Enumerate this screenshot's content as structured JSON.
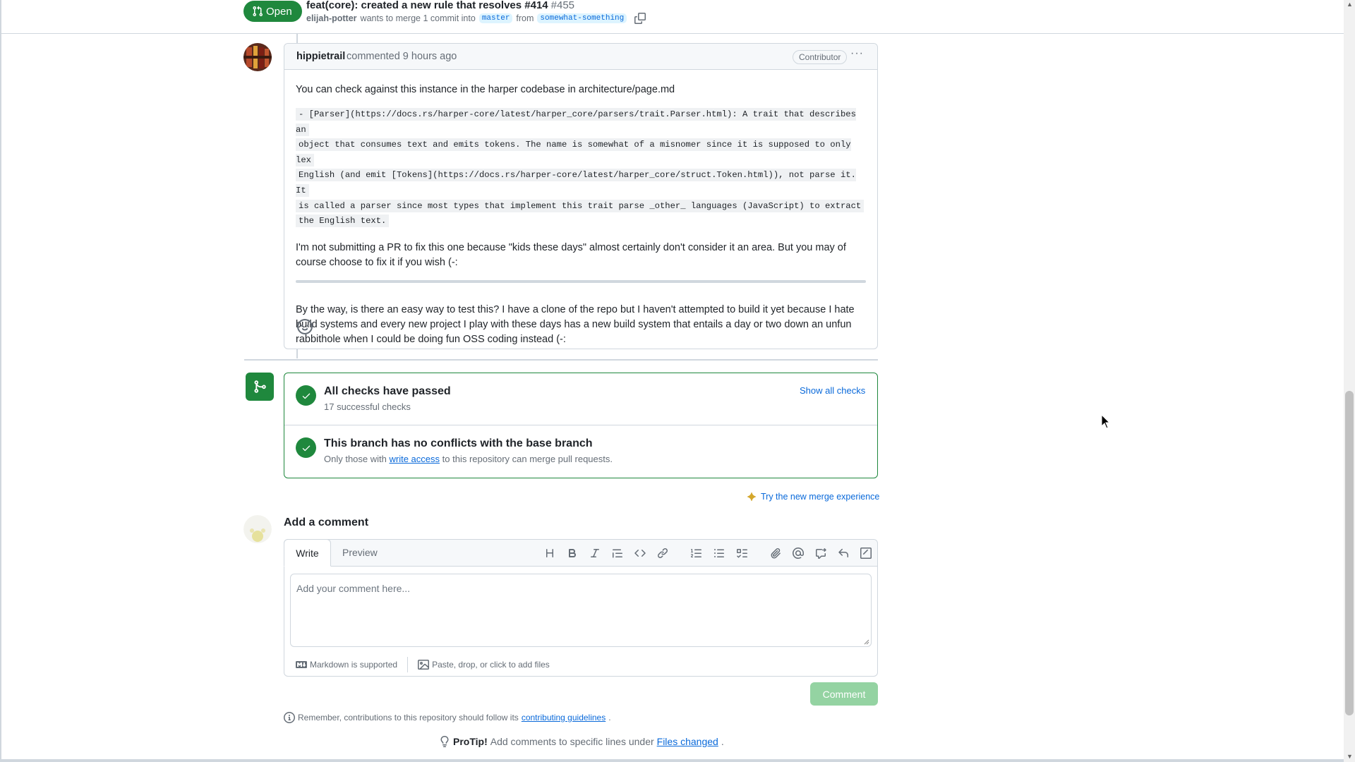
{
  "header": {
    "state_label": "Open",
    "title": "feat(core): created a new rule that resolves #414",
    "number": "#455",
    "author": "elijah-potter",
    "merge_text": "wants to merge 1 commit into",
    "base_branch": "master",
    "from_text": "from",
    "head_branch": "somewhat-something"
  },
  "comment": {
    "author": "hippietrail",
    "when": "commented 9 hours ago",
    "role": "Contributor",
    "menu": "···",
    "paragraph1": "You can check against this instance in the harper codebase in architecture/page.md",
    "code_lines": [
      " - [Parser](https://docs.rs/harper-core/latest/harper_core/parsers/trait.Parser.html): A trait that describes an",
      "object that consumes text and emits tokens. The name is somewhat of a misnomer since it is supposed to only lex",
      "English (and emit [Tokens](https://docs.rs/harper-core/latest/harper_core/struct.Token.html)), not parse it. It",
      "is called a parser since most types that implement this trait parse _other_ languages (JavaScript) to extract",
      "the English text."
    ],
    "paragraph2": "I'm not submitting a PR to fix this one because \"kids these days\" almost certainly don't consider it an area. But you may of course choose to fix it if you wish (-:",
    "paragraph3": "By the way, is there an easy way to test this? I have a clone of the repo but I haven't attempted to build it yet because I hate build systems and every new project I play with these days has a new build system that entails a day or two down an unfun rabbithole when I could be doing fun OSS coding instead (-:"
  },
  "merge": {
    "checks_title": "All checks have passed",
    "checks_sub": "17 successful checks",
    "show_all": "Show all checks",
    "conflict_title": "This branch has no conflicts with the base branch",
    "conflict_sub_pre": "Only those with",
    "conflict_link": "write access",
    "conflict_sub_post": "to this repository can merge pull requests.",
    "try_new": "Try the new merge experience"
  },
  "add_comment": {
    "title": "Add a comment",
    "tab_write": "Write",
    "tab_preview": "Preview",
    "placeholder": "Add your comment here...",
    "markdown_note": "Markdown is supported",
    "files_note": "Paste, drop, or click to add files",
    "submit": "Comment"
  },
  "footer": {
    "remember_pre": "Remember, contributions to this repository should follow its",
    "remember_link": "contributing guidelines",
    "remember_post": ".",
    "protip_label": "ProTip!",
    "protip_text": "Add comments to specific lines under",
    "protip_link": "Files changed",
    "protip_post": "."
  },
  "colors": {
    "success": "#1f883d",
    "link": "#0969da",
    "muted": "#656d76",
    "border": "#d0d7de"
  }
}
